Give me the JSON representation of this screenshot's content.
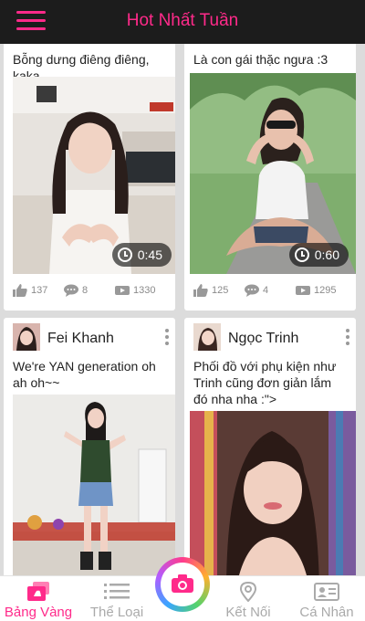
{
  "header": {
    "title": "Hot Nhất Tuần"
  },
  "feed": {
    "cards": [
      {
        "caption": "Bỗng dưng điêng điêng, kaka",
        "duration": "0:45",
        "likes": "137",
        "comments": "8",
        "views": "1330"
      },
      {
        "caption": "Là con gái thặc ngưa  :3",
        "duration": "0:60",
        "likes": "125",
        "comments": "4",
        "views": "1295"
      },
      {
        "user": "Fei Khanh",
        "caption": "We're YAN generation oh ah oh~~"
      },
      {
        "user": "Ngọc Trinh",
        "caption": "Phối đồ với phụ kiện như Trinh cũng đơn giản lắm đó nha nha :\">"
      }
    ]
  },
  "tabbar": {
    "tabs": [
      {
        "label": "Bảng Vàng",
        "icon": "trophy-cards-icon",
        "active": true
      },
      {
        "label": "Thể Loại",
        "icon": "list-icon",
        "active": false
      },
      {
        "label": "Kết Nối",
        "icon": "location-pin-icon",
        "active": false
      },
      {
        "label": "Cá Nhân",
        "icon": "profile-card-icon",
        "active": false
      }
    ],
    "camera_icon": "camera-icon"
  },
  "colors": {
    "accent": "#ff2a8a",
    "topbar": "#1c1c1c",
    "background": "#dcdcdc"
  }
}
